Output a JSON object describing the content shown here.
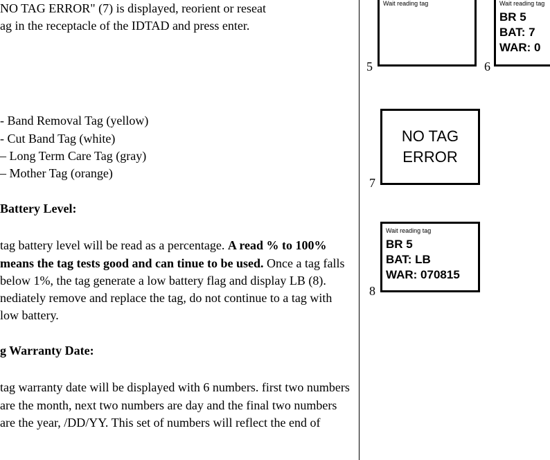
{
  "left": {
    "intro_line1": "NO TAG ERROR\" (7) is displayed, reorient or reseat",
    "intro_line2": "ag in the receptacle of the IDTAD and press enter.",
    "tags": [
      "- Band Removal Tag (yellow)",
      "- Cut Band Tag (white)",
      "– Long Term Care Tag (gray)",
      "– Mother Tag (orange)"
    ],
    "battery_heading": "Battery Level:",
    "battery_para": " tag battery level will be read as a percentage. ",
    "battery_bold": "A read % to 100% means the tag tests good and can tinue to be used.",
    "battery_after": " Once a tag falls below 1%, the tag  generate a low battery flag and display LB (8). nediately remove and replace the tag, do not continue to a tag with low battery.",
    "warranty_heading": "g Warranty Date:",
    "warranty_para": " tag warranty date will be displayed with 6 numbers.  first two numbers are the month, next two numbers are  day and the final two numbers are the year, /DD/YY. This set of numbers will reflect the end of "
  },
  "boxes": {
    "b5": {
      "small": "Wait reading tag"
    },
    "b6": {
      "small": "Wait reading tag",
      "l1": "BR 5",
      "l2": "BAT: 7",
      "l3": "WAR: 0"
    },
    "b7": {
      "l1": "NO TAG",
      "l2": "ERROR"
    },
    "b8": {
      "small": "Wait reading tag",
      "l1": "BR 5",
      "l2": "BAT: LB",
      "l3": "WAR: 070815"
    }
  },
  "labels": {
    "n5": "5",
    "n6": "6",
    "n7": "7",
    "n8": "8"
  }
}
